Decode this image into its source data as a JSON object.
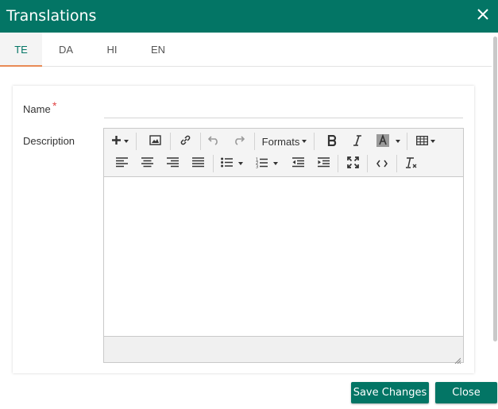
{
  "dialog": {
    "title": "Translations"
  },
  "tabs": [
    {
      "label": "TE",
      "active": true
    },
    {
      "label": "DA",
      "active": false
    },
    {
      "label": "HI",
      "active": false
    },
    {
      "label": "EN",
      "active": false
    }
  ],
  "form": {
    "name_label": "Name",
    "required_mark": "*",
    "description_label": "Description",
    "name_value": ""
  },
  "editor": {
    "formats_label": "Formats",
    "icons": [
      "plus-icon",
      "image-icon",
      "link-icon",
      "undo-icon",
      "redo-icon",
      "bold-icon",
      "italic-icon",
      "text-color-icon",
      "table-icon",
      "align-left-icon",
      "align-center-icon",
      "align-right-icon",
      "align-justify-icon",
      "bullet-list-icon",
      "numbered-list-icon",
      "outdent-icon",
      "indent-icon",
      "fullscreen-icon",
      "source-code-icon",
      "clear-format-icon"
    ],
    "content": ""
  },
  "footer": {
    "save_label": "Save Changes",
    "close_label": "Close"
  },
  "colors": {
    "primary": "#037565",
    "active_tab_underline": "#e88a55",
    "required": "#e04545"
  }
}
